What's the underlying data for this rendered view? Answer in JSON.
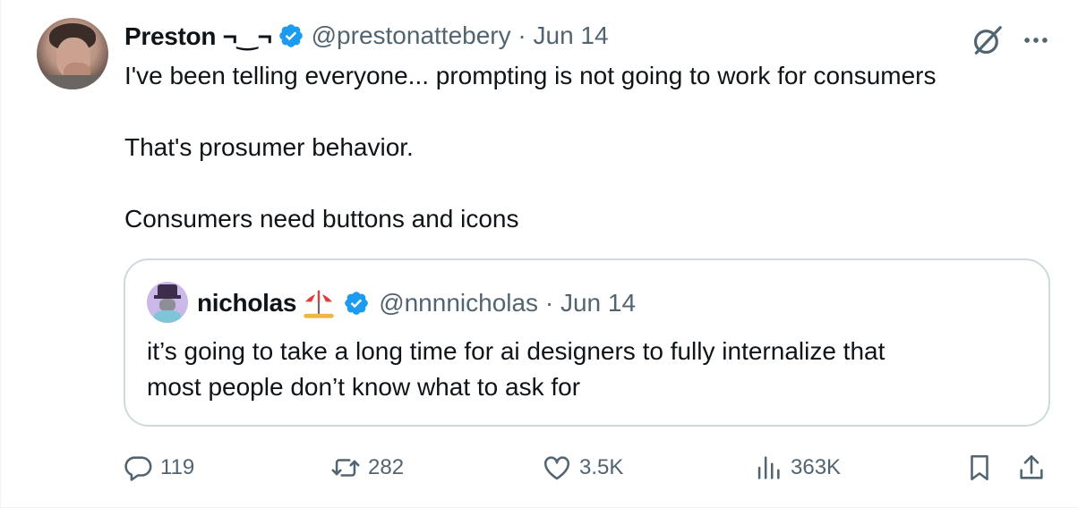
{
  "tweet": {
    "author_name": "Preston ¬‿¬",
    "meta": "@prestonattebery · Jun 14",
    "text_lines": [
      "I've been telling everyone... prompting is not going to work for consumers",
      "That's prosumer behavior.",
      "Consumers need buttons and icons"
    ]
  },
  "quote": {
    "author_name": "nicholas",
    "meta": "@nnnnicholas · Jun 14",
    "text_lines": [
      "it’s going to take a long time for ai designers to fully internalize that",
      "most people don’t know what to ask for"
    ]
  },
  "actions": {
    "replies": "119",
    "reposts": "282",
    "likes": "3.5K",
    "views": "363K"
  },
  "icons": {
    "verified": "verified-badge-icon",
    "grok": "grok-icon",
    "more": "more-options-icon",
    "reply": "reply-icon",
    "repost": "repost-icon",
    "like": "heart-icon",
    "views": "views-chart-icon",
    "bookmark": "bookmark-icon",
    "share": "share-icon",
    "emoji": "beach-umbrella-icon"
  },
  "colors": {
    "verified_blue": "#1d9bf0",
    "text": "#0f1419",
    "secondary": "#536471",
    "border": "#cfd9de"
  }
}
